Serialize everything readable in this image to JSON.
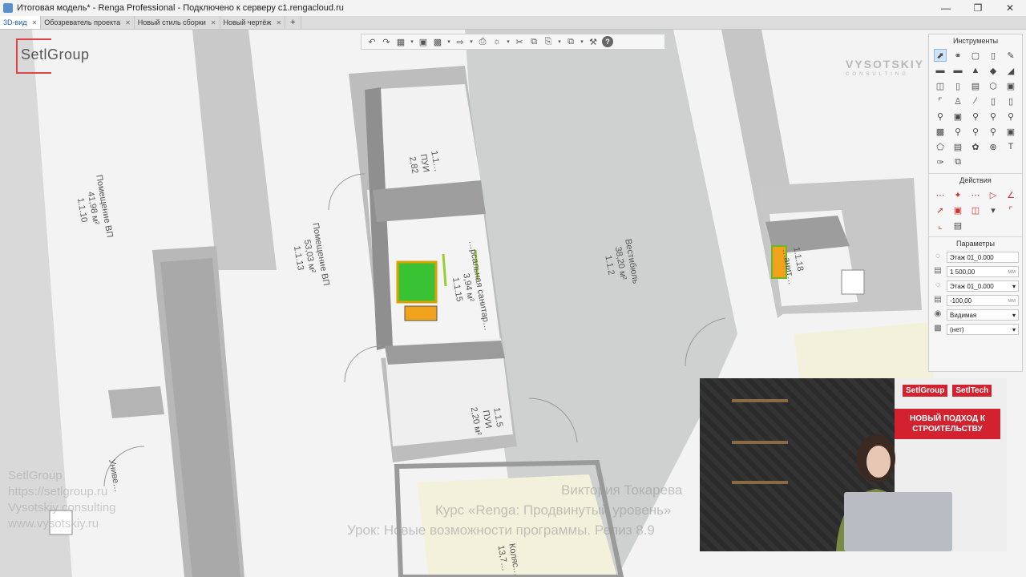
{
  "window": {
    "title": "Итоговая модель* - Renga Professional - Подключено к серверу c1.rengacloud.ru",
    "minimize_icon": "minimize-icon",
    "maximize_icon": "maximize-icon",
    "close_icon": "close-icon"
  },
  "tabs": [
    {
      "label": "3D-вид",
      "active": true
    },
    {
      "label": "Обозреватель проекта",
      "active": false
    },
    {
      "label": "Новый стиль сборки",
      "active": false
    },
    {
      "label": "Новый чертёж",
      "active": false
    }
  ],
  "tab_plus": "+",
  "logos": {
    "setl": "SetlGroup",
    "vysotskiy": "VYSOTSKIY",
    "vysotskiy_sub": "CONSULTING"
  },
  "rooms": [
    {
      "number": "1.1.10",
      "name": "Помещение ВП",
      "area": "41,98 м²"
    },
    {
      "number": "1.1.13",
      "name": "Помещение ВП",
      "area": "53,03 м²"
    },
    {
      "number": "1.1.15",
      "name": "…рсальная санитар…",
      "area": "3,94 м²"
    },
    {
      "number": "1.1…",
      "name": "ПУИ",
      "area": "2,82"
    },
    {
      "number": "1.1.5",
      "name": "ПУИ",
      "area": "2,20 м²"
    },
    {
      "number": "1.1.2",
      "name": "Вестибюль",
      "area": "38,20 м²"
    },
    {
      "number": "1.1.18",
      "name": "…анит…",
      "area": ""
    },
    {
      "number": "",
      "name": "Униве…",
      "area": ""
    },
    {
      "number": "",
      "name": "Коляс…",
      "area": "13,7…"
    }
  ],
  "panel": {
    "tools_title": "Инструменты",
    "actions_title": "Действия",
    "params_title": "Параметры",
    "params": [
      {
        "icon": "level-icon",
        "value": "Этаж 01_0.000",
        "unit": "",
        "dropdown": false
      },
      {
        "icon": "height-icon",
        "value": "1 500,00",
        "unit": "мм",
        "dropdown": false
      },
      {
        "icon": "level-icon",
        "value": "Этаж 01_0.000",
        "unit": "",
        "dropdown": true
      },
      {
        "icon": "offset-icon",
        "value": "-100,00",
        "unit": "мм",
        "dropdown": false
      },
      {
        "icon": "visibility-icon",
        "value": "Видимая",
        "unit": "",
        "dropdown": true
      },
      {
        "icon": "material-icon",
        "value": "(нет)",
        "unit": "",
        "dropdown": true
      }
    ]
  },
  "overlay": {
    "author": "Виктория Токарева",
    "course": "Курс «Renga: Продвинутый уровень»",
    "lesson": "Урок: Новые возможности программы. Релиз 8.9",
    "left_lines": [
      "SetlGroup",
      "https://setlgroup.ru",
      "Vysotskiy consulting",
      "www.vysotskiy.ru"
    ]
  },
  "webcam": {
    "brand1": "SetlGroup",
    "brand2": "SetlTech",
    "slogan": "НОВЫЙ ПОДХОД К СТРОИТЕЛЬСТВУ"
  }
}
